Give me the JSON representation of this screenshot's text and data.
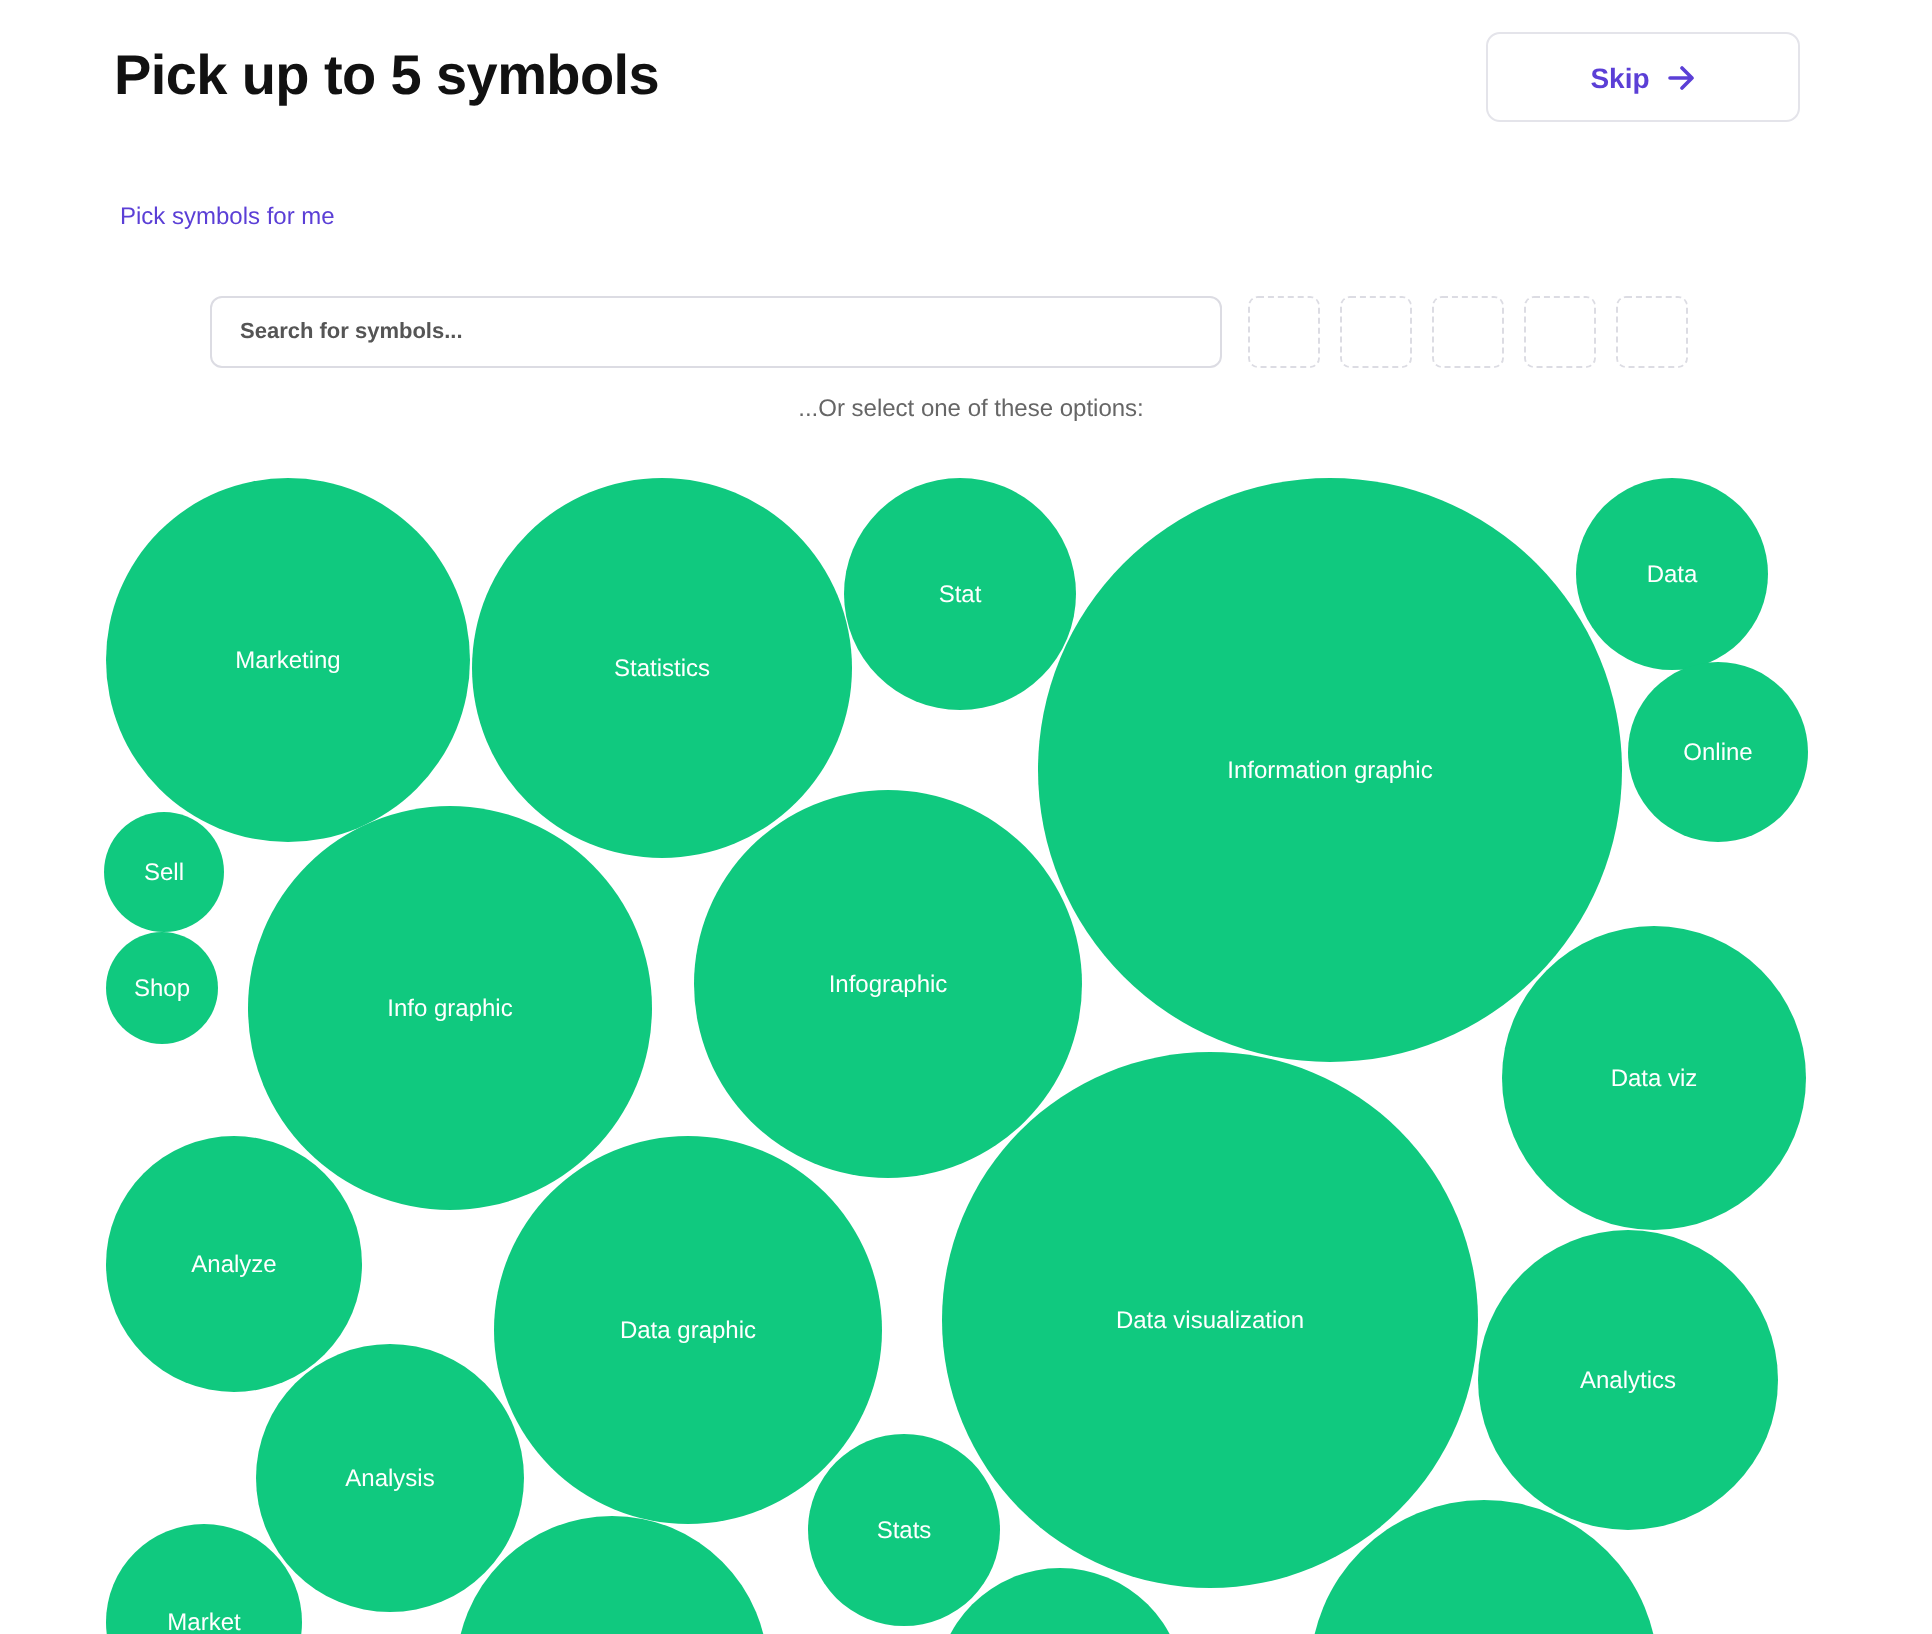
{
  "header": {
    "title": "Pick up to 5 symbols",
    "skip_button": "Skip"
  },
  "auto_pick_link": "Pick symbols for me",
  "search": {
    "placeholder": "Search for symbols..."
  },
  "slots": [
    {
      "filled": false
    },
    {
      "filled": false
    },
    {
      "filled": false
    },
    {
      "filled": false
    },
    {
      "filled": false
    }
  ],
  "options_hint": "...Or select one of these options:",
  "options": [
    {
      "label": "Marketing"
    },
    {
      "label": "Statistics"
    },
    {
      "label": "Stat"
    },
    {
      "label": "Information graphic"
    },
    {
      "label": "Data"
    },
    {
      "label": "Online"
    },
    {
      "label": "Sell"
    },
    {
      "label": "Shop"
    },
    {
      "label": "Info graphic"
    },
    {
      "label": "Infographic"
    },
    {
      "label": "Data viz"
    },
    {
      "label": "Analyze"
    },
    {
      "label": "Data graphic"
    },
    {
      "label": "Data visualization"
    },
    {
      "label": "Analytics"
    },
    {
      "label": "Analysis"
    },
    {
      "label": "Stats"
    },
    {
      "label": "Market"
    },
    {
      "kind": "blank"
    },
    {
      "kind": "blank"
    },
    {
      "kind": "blank"
    }
  ]
}
